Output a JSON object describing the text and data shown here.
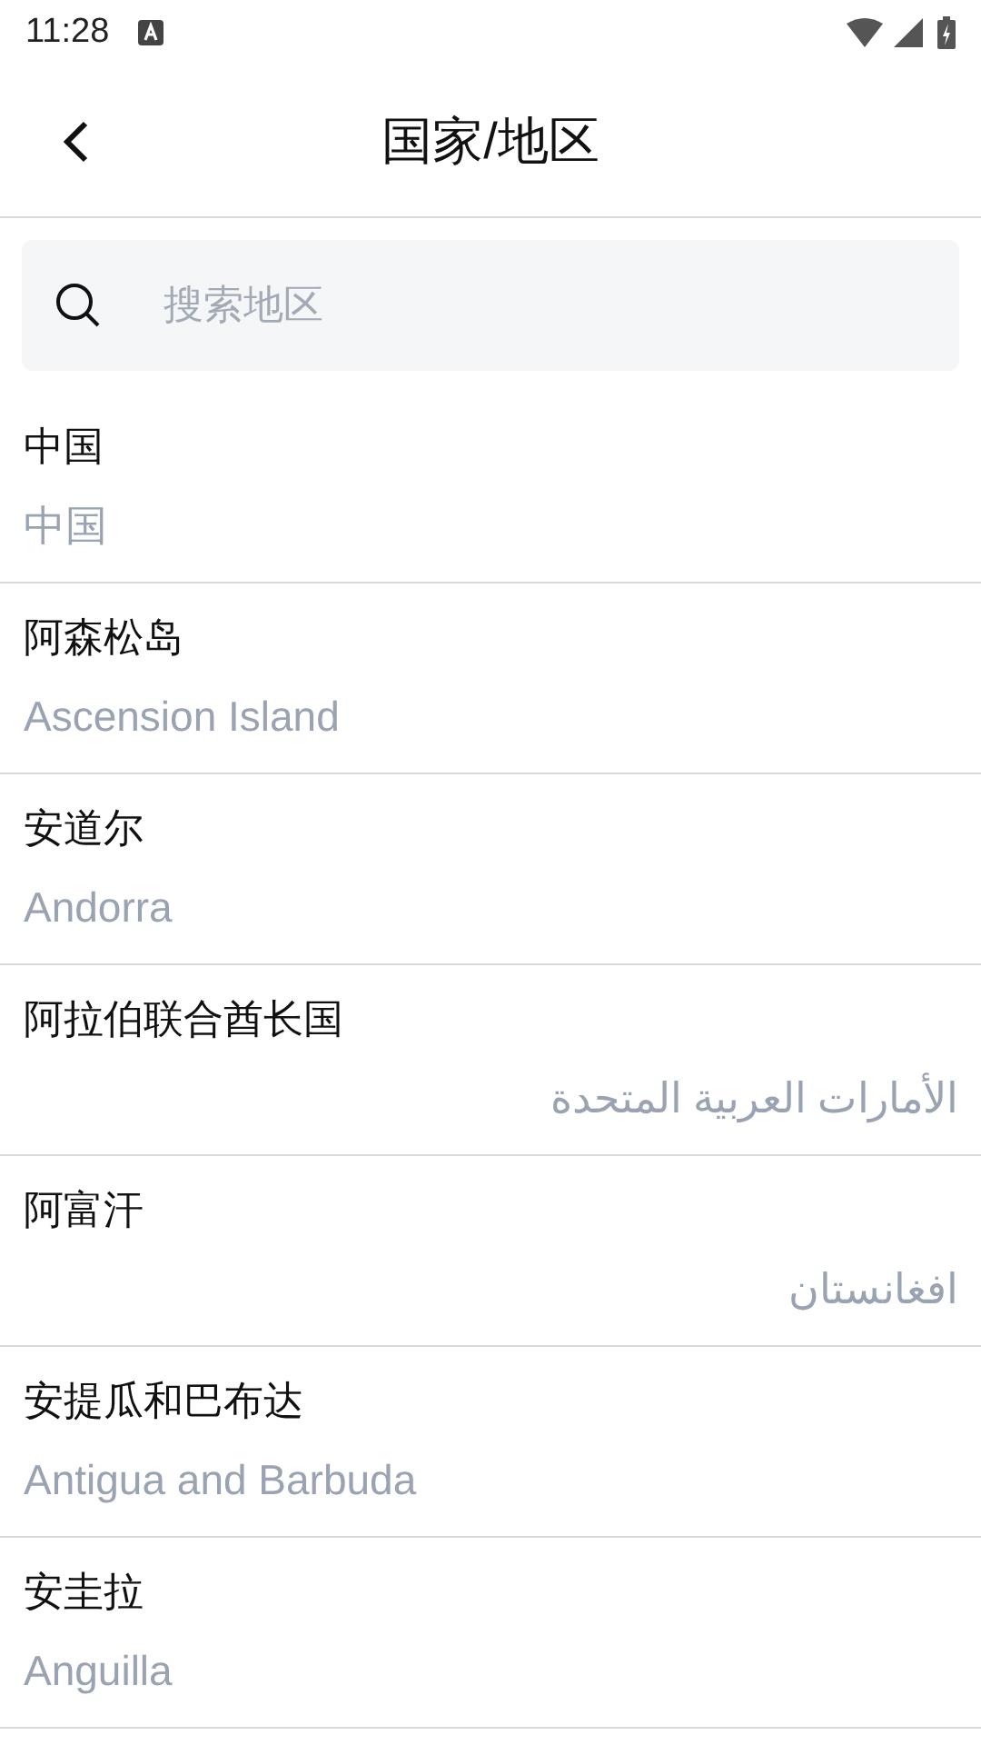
{
  "status_bar": {
    "time": "11:28"
  },
  "header": {
    "title": "国家/地区"
  },
  "search": {
    "placeholder": "搜索地区"
  },
  "regions": [
    {
      "name": "中国",
      "native": "中国",
      "kind": "ltr"
    },
    {
      "name": "阿森松岛",
      "native": "Ascension Island",
      "kind": "ltr"
    },
    {
      "name": "安道尔",
      "native": "Andorra",
      "kind": "ltr"
    },
    {
      "name": "阿拉伯联合酋长国",
      "native": "الأمارات العربية المتحدة",
      "kind": "rtl"
    },
    {
      "name": "阿富汗",
      "native": "افغانستان",
      "kind": "rtl"
    },
    {
      "name": "安提瓜和巴布达",
      "native": "Antigua and Barbuda",
      "kind": "ltr"
    },
    {
      "name": "安圭拉",
      "native": "Anguilla",
      "kind": "ltr"
    }
  ]
}
